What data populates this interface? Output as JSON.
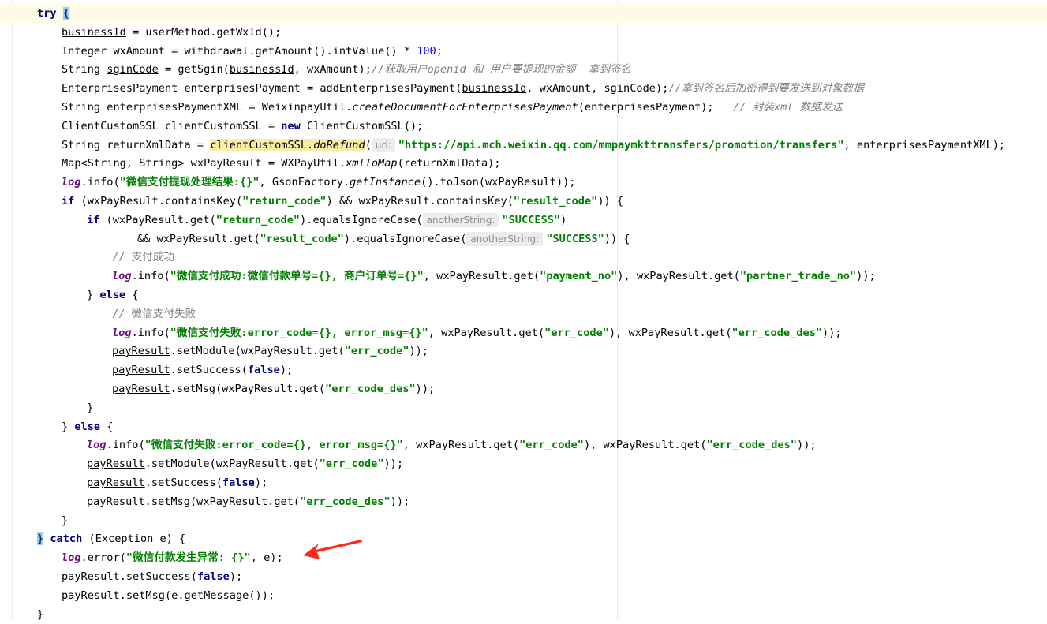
{
  "editor": {
    "lines": [
      [
        [
          "kw",
          "try"
        ],
        [
          "t",
          " "
        ],
        [
          "brace",
          "{"
        ]
      ],
      [
        [
          "ul",
          "businessId"
        ],
        [
          "t",
          " = userMethod.getWxId();"
        ]
      ],
      [
        [
          "t",
          "Integer wxAmount = withdrawal.getAmount().intValue() * "
        ],
        [
          "num",
          "100"
        ],
        [
          "t",
          ";"
        ]
      ],
      [
        [
          "t",
          "String "
        ],
        [
          "ul",
          "sginCode"
        ],
        [
          "t",
          " = getSgin("
        ],
        [
          "ul",
          "businessId"
        ],
        [
          "t",
          ", wxAmount);"
        ],
        [
          "cm",
          "//获取用户openid 和 用户要提现的金额  拿到签名"
        ]
      ],
      [
        [
          "t",
          "EnterprisesPayment enterprisesPayment = addEnterprisesPayment("
        ],
        [
          "ul",
          "businessId"
        ],
        [
          "t",
          ", wxAmount, sginCode);"
        ],
        [
          "cm",
          "//拿到签名后加密得到要发送到对象数据"
        ]
      ],
      [
        [
          "t",
          "String enterprisesPaymentXML = WeixinpayUtil."
        ],
        [
          "st",
          "createDocumentForEnterprisesPayment"
        ],
        [
          "t",
          "(enterprisesPayment);   "
        ],
        [
          "cm",
          "// 封装xml 数据发送"
        ]
      ],
      [
        [
          "t",
          "ClientCustomSSL clientCustomSSL = "
        ],
        [
          "kw",
          "new"
        ],
        [
          "t",
          " ClientCustomSSL();"
        ]
      ],
      [
        [
          "t",
          "String returnXmlData = "
        ],
        [
          "hl",
          "clientCustomSSL."
        ],
        [
          "hlst",
          "doRefund"
        ],
        [
          "t",
          "("
        ],
        [
          "hint",
          "url:"
        ],
        [
          "str",
          "\"https://api.mch.weixin.qq.com/mmpaymkttransfers/promotion/transfers\""
        ],
        [
          "t",
          ", enterprisesPaymentXML);"
        ]
      ],
      [
        [
          "t",
          "Map<String, String> wxPayResult = WXPayUtil."
        ],
        [
          "st",
          "xmlToMap"
        ],
        [
          "t",
          "(returnXmlData);"
        ]
      ],
      [
        [
          "fld",
          "log"
        ],
        [
          "t",
          ".info("
        ],
        [
          "str",
          "\"微信支付提现处理结果:{}\""
        ],
        [
          "t",
          ", GsonFactory."
        ],
        [
          "st",
          "getInstance"
        ],
        [
          "t",
          "().toJson(wxPayResult));"
        ]
      ],
      [
        [
          "kw",
          "if"
        ],
        [
          "t",
          " (wxPayResult.containsKey("
        ],
        [
          "str",
          "\"return_code\""
        ],
        [
          "t",
          ") && wxPayResult.containsKey("
        ],
        [
          "str",
          "\"result_code\""
        ],
        [
          "t",
          ")) {"
        ]
      ],
      [
        [
          "kw",
          "if"
        ],
        [
          "t",
          " (wxPayResult.get("
        ],
        [
          "str",
          "\"return_code\""
        ],
        [
          "t",
          ").equalsIgnoreCase("
        ],
        [
          "hint",
          "anotherString:"
        ],
        [
          "str",
          "\"SUCCESS\""
        ],
        [
          "t",
          ")"
        ]
      ],
      [
        [
          "t",
          "&& wxPayResult.get("
        ],
        [
          "str",
          "\"result_code\""
        ],
        [
          "t",
          ").equalsIgnoreCase("
        ],
        [
          "hint",
          "anotherString:"
        ],
        [
          "str",
          "\"SUCCESS\""
        ],
        [
          "t",
          ")) {"
        ]
      ],
      [
        [
          "cmplain",
          "// 支付成功"
        ]
      ],
      [
        [
          "fld",
          "log"
        ],
        [
          "t",
          ".info("
        ],
        [
          "str",
          "\"微信支付成功:微信付款单号={}, 商户订单号={}\""
        ],
        [
          "t",
          ", wxPayResult.get("
        ],
        [
          "str",
          "\"payment_no\""
        ],
        [
          "t",
          "), wxPayResult.get("
        ],
        [
          "str",
          "\"partner_trade_no\""
        ],
        [
          "t",
          "));"
        ]
      ],
      [
        [
          "t",
          "} "
        ],
        [
          "kw",
          "else"
        ],
        [
          "t",
          " {"
        ]
      ],
      [
        [
          "cmplain",
          "// 微信支付失败"
        ]
      ],
      [
        [
          "fld",
          "log"
        ],
        [
          "t",
          ".info("
        ],
        [
          "str",
          "\"微信支付失败:error_code={}, error_msg={}\""
        ],
        [
          "t",
          ", wxPayResult.get("
        ],
        [
          "str",
          "\"err_code\""
        ],
        [
          "t",
          "), wxPayResult.get("
        ],
        [
          "str",
          "\"err_code_des\""
        ],
        [
          "t",
          "));"
        ]
      ],
      [
        [
          "ul",
          "payResult"
        ],
        [
          "t",
          ".setModule(wxPayResult.get("
        ],
        [
          "str",
          "\"err_code\""
        ],
        [
          "t",
          "));"
        ]
      ],
      [
        [
          "ul",
          "payResult"
        ],
        [
          "t",
          ".setSuccess("
        ],
        [
          "kw",
          "false"
        ],
        [
          "t",
          ");"
        ]
      ],
      [
        [
          "ul",
          "payResult"
        ],
        [
          "t",
          ".setMsg(wxPayResult.get("
        ],
        [
          "str",
          "\"err_code_des\""
        ],
        [
          "t",
          "));"
        ]
      ],
      [
        [
          "t",
          "}"
        ]
      ],
      [
        [
          "t",
          "} "
        ],
        [
          "kw",
          "else"
        ],
        [
          "t",
          " {"
        ]
      ],
      [
        [
          "fld",
          "log"
        ],
        [
          "t",
          ".info("
        ],
        [
          "str",
          "\"微信支付失败:error_code={}, error_msg={}\""
        ],
        [
          "t",
          ", wxPayResult.get("
        ],
        [
          "str",
          "\"err_code\""
        ],
        [
          "t",
          "), wxPayResult.get("
        ],
        [
          "str",
          "\"err_code_des\""
        ],
        [
          "t",
          "));"
        ]
      ],
      [
        [
          "ul",
          "payResult"
        ],
        [
          "t",
          ".setModule(wxPayResult.get("
        ],
        [
          "str",
          "\"err_code\""
        ],
        [
          "t",
          "));"
        ]
      ],
      [
        [
          "ul",
          "payResult"
        ],
        [
          "t",
          ".setSuccess("
        ],
        [
          "kw",
          "false"
        ],
        [
          "t",
          ");"
        ]
      ],
      [
        [
          "ul",
          "payResult"
        ],
        [
          "t",
          ".setMsg(wxPayResult.get("
        ],
        [
          "str",
          "\"err_code_des\""
        ],
        [
          "t",
          "));"
        ]
      ],
      [
        [
          "t",
          "}"
        ]
      ],
      [
        [
          "brace",
          "}"
        ],
        [
          "t",
          " "
        ],
        [
          "kw",
          "catch"
        ],
        [
          "t",
          " (Exception e) {"
        ]
      ],
      [
        [
          "fld",
          "log"
        ],
        [
          "t",
          ".error("
        ],
        [
          "str",
          "\"微信付款发生异常: {}\""
        ],
        [
          "t",
          ", e);"
        ]
      ],
      [
        [
          "ul",
          "payResult"
        ],
        [
          "t",
          ".setSuccess("
        ],
        [
          "kw",
          "false"
        ],
        [
          "t",
          ");"
        ]
      ],
      [
        [
          "ul",
          "payResult"
        ],
        [
          "t",
          ".setMsg(e.getMessage());"
        ]
      ],
      [
        [
          "t",
          "}"
        ]
      ]
    ]
  },
  "annotation": {
    "arrow_color": "#ff2a1a"
  }
}
